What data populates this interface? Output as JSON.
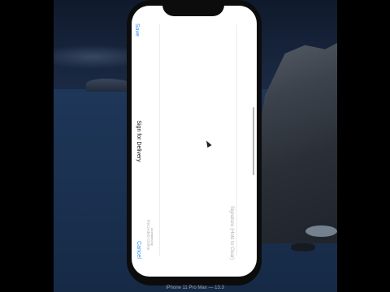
{
  "toolbar": {
    "save_label": "Save",
    "cancel_label": "Cancel",
    "title": "Sign for Delivery"
  },
  "form": {
    "name_placeholder": "Recorded Online",
    "name_sublabel": "Accepted by",
    "signature_hint": "Signature (Hold to Clear)"
  },
  "device_caption": "iPhone 11 Pro Max — 13.3",
  "colors": {
    "accent": "#2d8cf0",
    "screen_bg": "#ffffff",
    "device_frame": "#0c0c0c"
  }
}
